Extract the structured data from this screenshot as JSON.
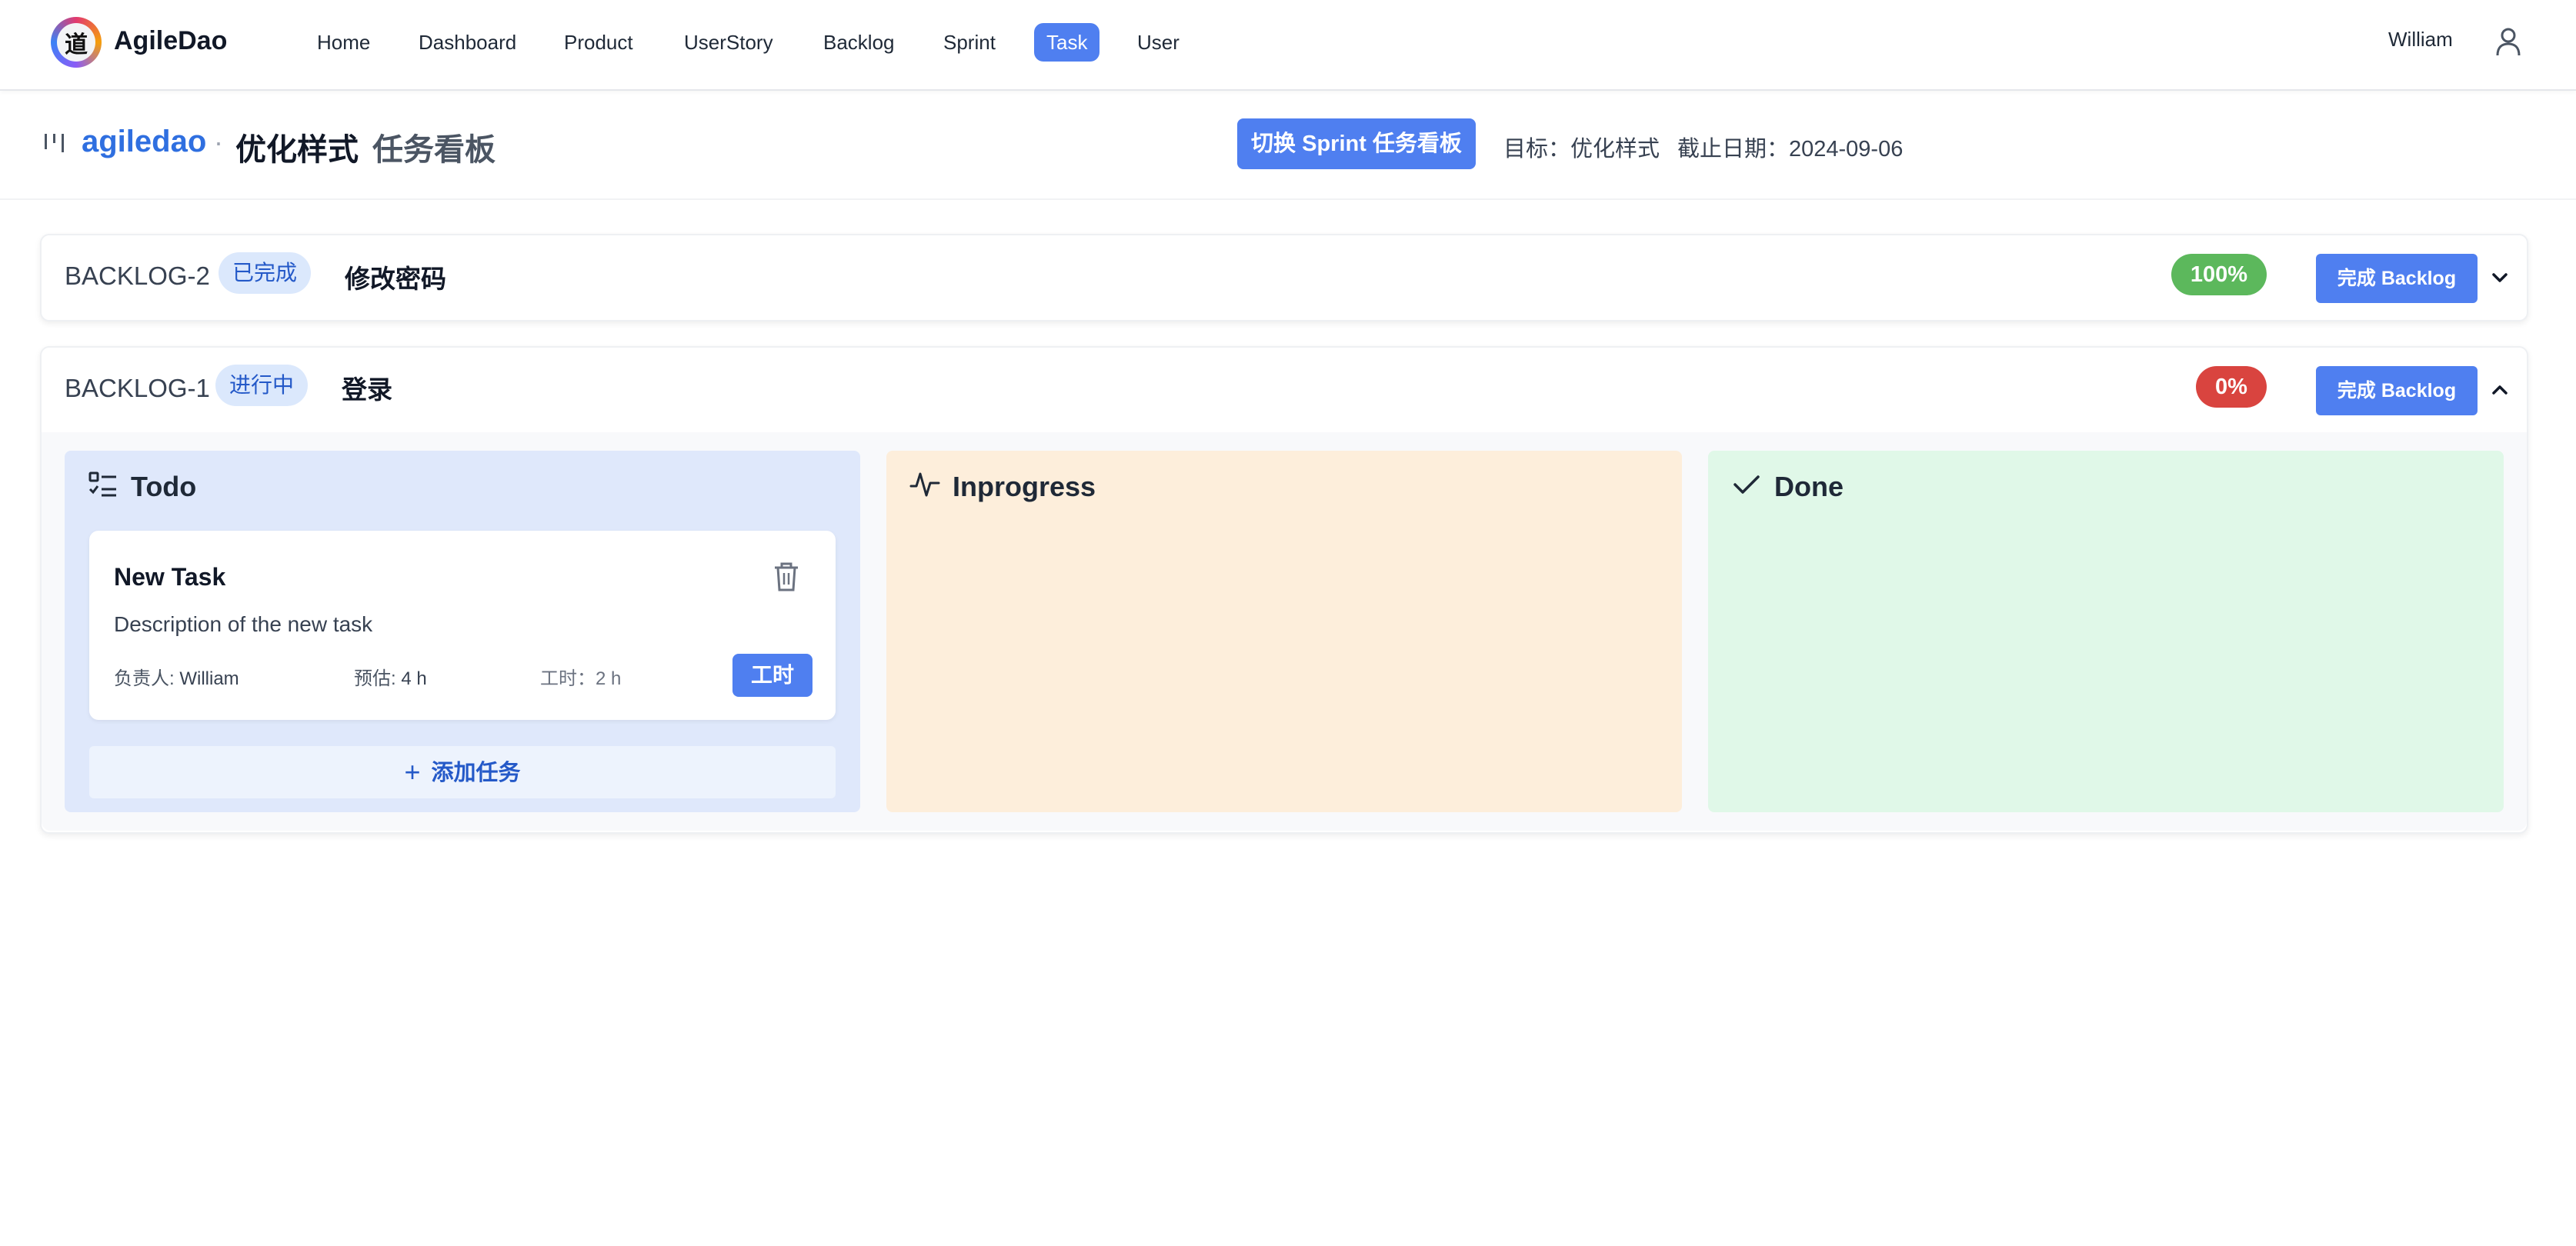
{
  "app": {
    "logo_char": "道",
    "brand": "AgileDao"
  },
  "nav": {
    "items": [
      {
        "label": "Home"
      },
      {
        "label": "Dashboard"
      },
      {
        "label": "Product"
      },
      {
        "label": "UserStory"
      },
      {
        "label": "Backlog"
      },
      {
        "label": "Sprint"
      },
      {
        "label": "Task",
        "active": true
      },
      {
        "label": "User"
      }
    ],
    "user_name": "William"
  },
  "header": {
    "project": "agiledao",
    "separator": "·",
    "sprint": "优化样式",
    "board_title": "任务看板",
    "switch_button": "切换 Sprint 任务看板",
    "goal": "目标：优化样式",
    "deadline": "截止日期：2024-09-06"
  },
  "backlogs": [
    {
      "id": "BACKLOG-2",
      "status": "已完成",
      "title": "修改密码",
      "percent": "100%",
      "percent_color": "#5cb85c",
      "complete_button": "完成 Backlog",
      "expanded": false
    },
    {
      "id": "BACKLOG-1",
      "status": "进行中",
      "title": "登录",
      "percent": "0%",
      "percent_color": "#d9443f",
      "complete_button": "完成 Backlog",
      "expanded": true,
      "columns": [
        {
          "title": "Todo",
          "icon": "list-check-icon",
          "tasks": [
            {
              "title": "New Task",
              "description": "Description of the new task",
              "assignee_label": "负责人:",
              "assignee": "William",
              "estimate_label": "预估:",
              "estimate": "4 h",
              "hours_label": "工时：",
              "hours": "2 h",
              "hours_button": "工时"
            }
          ],
          "add_task": "添加任务"
        },
        {
          "title": "Inprogress",
          "icon": "activity-icon",
          "tasks": []
        },
        {
          "title": "Done",
          "icon": "check-icon",
          "tasks": []
        }
      ]
    }
  ],
  "colors": {
    "primary": "#4f7ff0",
    "project_link": "#2f6fe0",
    "todo_bg": "#dfe8fb",
    "inprogress_bg": "#fdeedb",
    "done_bg": "#e0f8e8"
  }
}
